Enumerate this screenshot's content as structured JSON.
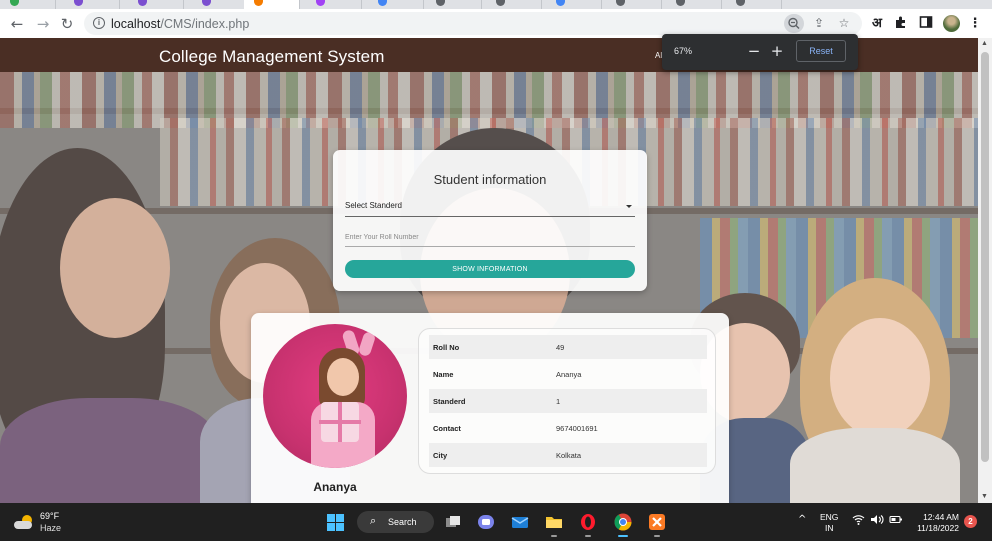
{
  "browser": {
    "url_host": "localhost",
    "url_path": "/CMS/index.php",
    "zoom": {
      "percent": "67%",
      "minus": "−",
      "plus": "+",
      "reset_label": "Reset"
    },
    "icons": [
      "back-icon",
      "forward-icon",
      "reload-icon",
      "info-icon",
      "zoom-icon",
      "share-icon",
      "star-icon",
      "translate-icon",
      "extensions-icon",
      "side-panel-icon",
      "profile-avatar",
      "more-menu-icon"
    ],
    "translate_glyph": "अ"
  },
  "page": {
    "brand": "College Management System",
    "nav_link": "Al",
    "form": {
      "title": "Student information",
      "select_label": "Select Standerd",
      "roll_placeholder": "Enter Your Roll Number",
      "roll_value": "",
      "button_label": "SHOW INFORMATION"
    },
    "student": {
      "name": "Ananya",
      "fields": [
        {
          "key": "Roll No",
          "value": "49"
        },
        {
          "key": "Name",
          "value": "Ananya"
        },
        {
          "key": "Standerd",
          "value": "1"
        },
        {
          "key": "Contact",
          "value": "9674001691"
        },
        {
          "key": "City",
          "value": "Kolkata"
        }
      ]
    }
  },
  "taskbar": {
    "weather": {
      "temp": "69°F",
      "condition": "Haze"
    },
    "search_label": "Search",
    "apps": [
      "start-icon",
      "task-view-icon",
      "teams-icon",
      "mail-icon",
      "file-explorer-icon",
      "opera-icon",
      "chrome-icon",
      "xampp-icon"
    ],
    "language": {
      "line1": "ENG",
      "line2": "IN"
    },
    "clock": {
      "time": "12:44 AM",
      "date": "11/18/2022"
    },
    "notifications": "2",
    "colors": {
      "accent": "#4cc2ff",
      "badge": "#e8554e"
    }
  },
  "theme": {
    "navbar": "#4a2e24",
    "button": "#26a69a",
    "photo_bg": "#c8326f"
  }
}
